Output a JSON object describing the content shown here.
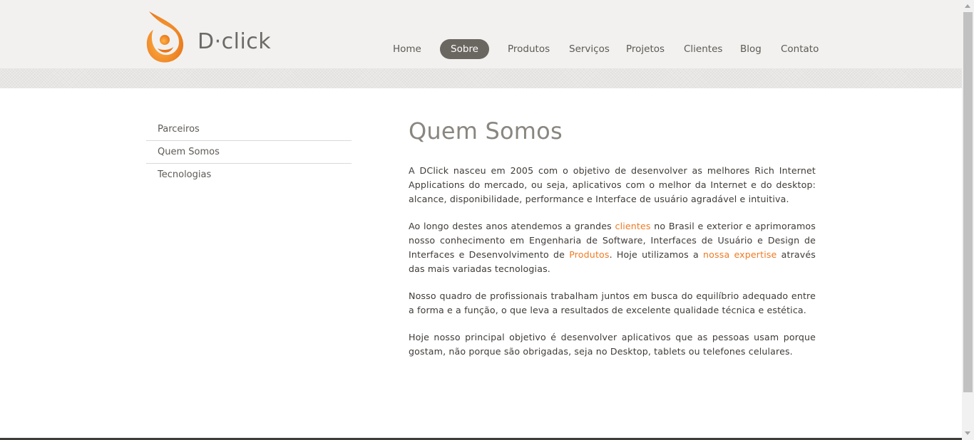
{
  "brand": {
    "name": "D·click",
    "accent_color": "#ef7a23",
    "logo_icon": "dclick-swirl-logo-icon"
  },
  "nav": {
    "items": [
      {
        "label": "Home"
      },
      {
        "label": "Sobre",
        "active": true
      },
      {
        "label": "Produtos"
      },
      {
        "label": "Serviços"
      },
      {
        "label": "Projetos"
      },
      {
        "label": "Clientes"
      },
      {
        "label": "Blog"
      },
      {
        "label": "Contato"
      }
    ]
  },
  "sidebar": {
    "items": [
      {
        "label": "Parceiros"
      },
      {
        "label": "Quem Somos"
      },
      {
        "label": "Tecnologias"
      }
    ]
  },
  "content": {
    "title": "Quem Somos",
    "p1": "A DClick nasceu em 2005 com o objetivo de desenvolver as melhores Rich Internet Applications do mercado, ou seja, aplicativos com o melhor da Internet e do desktop: alcance, disponibilidade, performance e Interface de usuário agradável e intuitiva.",
    "p2": {
      "t1": "Ao longo destes anos atendemos a grandes ",
      "link_clientes": "clientes",
      "t2": " no Brasil e exterior e aprimoramos nosso conhecimento em Engenharia de Software, Interfaces de Usuário e Design de Interfaces e Desenvolvimento de ",
      "link_produtos": "Produtos",
      "t3": ". Hoje utilizamos a ",
      "link_expertise": "nossa expertise",
      "t4": " através das mais variadas tecnologias."
    },
    "p3": "Nosso quadro de profissionais trabalham juntos em busca do equilíbrio adequado entre a forma e a função, o que leva a resultados de excelente qualidade técnica e estética.",
    "p4": "Hoje nosso principal objetivo é desenvolver aplicativos que as pessoas usam porque gostam, não porque são obrigadas, seja no Desktop, tablets ou telefones celulares."
  }
}
